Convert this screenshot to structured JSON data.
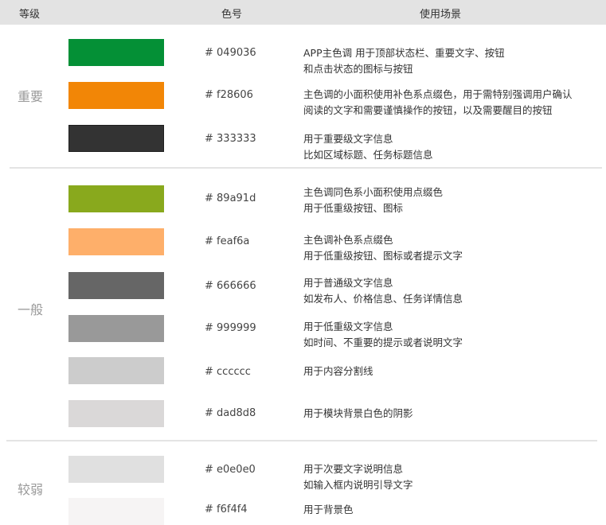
{
  "header": {
    "level": "等级",
    "code": "色号",
    "usage": "使用场景"
  },
  "levels": {
    "important": "重要",
    "normal": "一般",
    "weak": "较弱"
  },
  "colors": [
    {
      "hex": "#049036",
      "code": "# 049036",
      "desc1": "APP主色调 用于顶部状态栏、重要文字、按钮",
      "desc2": "和点击状态的图标与按钮"
    },
    {
      "hex": "#f28606",
      "code": "# f28606",
      "desc1": "主色调的小面积使用补色系点缀色，用于需特别强调用户确认",
      "desc2": "阅读的文字和需要谨慎操作的按钮，以及需要醒目的按钮"
    },
    {
      "hex": "#333333",
      "code": "# 333333",
      "desc1": "用于重要级文字信息",
      "desc2": "比如区域标题、任务标题信息"
    },
    {
      "hex": "#89a91d",
      "code": "# 89a91d",
      "desc1": "主色调同色系小面积使用点缀色",
      "desc2": "用于低重级按钮、图标"
    },
    {
      "hex": "#feaf6a",
      "code": "# feaf6a",
      "desc1": "主色调补色系点缀色",
      "desc2": "用于低重级按钮、图标或者提示文字"
    },
    {
      "hex": "#666666",
      "code": "# 666666",
      "desc1": "用于普通级文字信息",
      "desc2": "如发布人、价格信息、任务详情信息"
    },
    {
      "hex": "#999999",
      "code": "# 999999",
      "desc1": "用于低重级文字信息",
      "desc2": "如时间、不重要的提示或者说明文字"
    },
    {
      "hex": "#cccccc",
      "code": "# cccccc",
      "desc1": "用于内容分割线",
      "desc2": ""
    },
    {
      "hex": "#dad8d8",
      "code": "# dad8d8",
      "desc1": "用于模块背景白色的阴影",
      "desc2": ""
    },
    {
      "hex": "#e0e0e0",
      "code": "# e0e0e0",
      "desc1": "用于次要文字说明信息",
      "desc2": "如输入框内说明引导文字"
    },
    {
      "hex": "#f6f4f4",
      "code": "# f6f4f4",
      "desc1": "用于背景色",
      "desc2": ""
    }
  ]
}
